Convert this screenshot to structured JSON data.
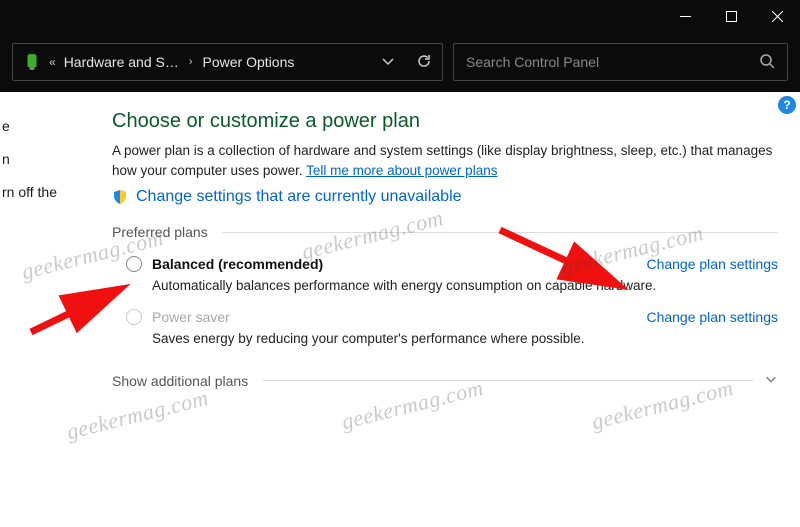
{
  "titlebar": {},
  "address": {
    "crumb_prev": "Hardware and S…",
    "crumb_current": "Power Options"
  },
  "search": {
    "placeholder": "Search Control Panel"
  },
  "leftpane": {
    "item1": "e",
    "item2": "n",
    "item3": "rn off the"
  },
  "page": {
    "title": "Choose or customize a power plan",
    "desc_a": "A power plan is a collection of hardware and system settings (like display brightness, sleep, etc.) that manages how your computer uses power. ",
    "desc_link": "Tell me more about power plans",
    "shield_link": "Change settings that are currently unavailable",
    "preferred_heading": "Preferred plans",
    "additional_heading": "Show additional plans"
  },
  "plans": [
    {
      "name": "Balanced (recommended)",
      "desc": "Automatically balances performance with energy consumption on capable hardware.",
      "change": "Change plan settings",
      "disabled": false
    },
    {
      "name": "Power saver",
      "desc": "Saves energy by reducing your computer's performance where possible.",
      "change": "Change plan settings",
      "disabled": true
    }
  ],
  "watermark": "geekermag.com",
  "help_badge": "?"
}
